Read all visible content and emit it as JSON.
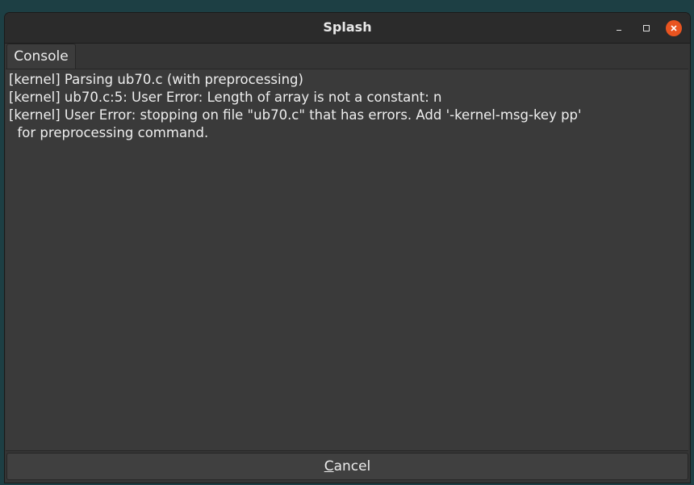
{
  "window": {
    "title": "Splash"
  },
  "tabs": [
    {
      "label": "Console"
    }
  ],
  "console": {
    "lines": [
      "[kernel] Parsing ub70.c (with preprocessing)",
      "[kernel] ub70.c:5: User Error: Length of array is not a constant: n",
      "[kernel] User Error: stopping on file \"ub70.c\" that has errors. Add '-kernel-msg-key pp'",
      "  for preprocessing command."
    ]
  },
  "buttons": {
    "cancel_mnemonic": "C",
    "cancel_rest": "ancel"
  },
  "colors": {
    "close_button": "#e95420",
    "desktop_bg": "#1d3f44"
  }
}
